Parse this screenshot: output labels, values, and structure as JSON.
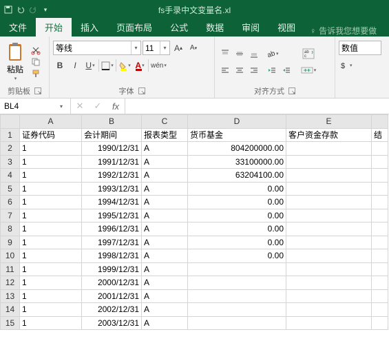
{
  "titlebar": {
    "filename": "fs手录中文变量名.xl"
  },
  "tabs": {
    "file": "文件",
    "home": "开始",
    "insert": "插入",
    "layout": "页面布局",
    "formulas": "公式",
    "data": "数据",
    "review": "审阅",
    "view": "视图",
    "tellme": "告诉我您想要做"
  },
  "ribbon": {
    "clipboard": {
      "paste": "粘贴",
      "label": "剪贴板"
    },
    "font": {
      "name": "等线",
      "size": "11",
      "label": "字体",
      "wen": "wén"
    },
    "alignment": {
      "label": "对齐方式"
    },
    "number": {
      "format": "数值"
    }
  },
  "formula_bar": {
    "cell_ref": "BL4",
    "fx": "fx"
  },
  "sheet": {
    "columns": [
      "A",
      "B",
      "C",
      "D",
      "E",
      ""
    ],
    "headers": {
      "A": "证券代码",
      "B": "会计期间",
      "C": "报表类型",
      "D": "货币基金",
      "E": "客户资金存款",
      "F": "结"
    },
    "rows": [
      {
        "n": "2",
        "A": "1",
        "B": "1990/12/31",
        "C": "A",
        "D": "804200000.00",
        "E": ""
      },
      {
        "n": "3",
        "A": "1",
        "B": "1991/12/31",
        "C": "A",
        "D": "33100000.00",
        "E": ""
      },
      {
        "n": "4",
        "A": "1",
        "B": "1992/12/31",
        "C": "A",
        "D": "63204100.00",
        "E": ""
      },
      {
        "n": "5",
        "A": "1",
        "B": "1993/12/31",
        "C": "A",
        "D": "0.00",
        "E": ""
      },
      {
        "n": "6",
        "A": "1",
        "B": "1994/12/31",
        "C": "A",
        "D": "0.00",
        "E": ""
      },
      {
        "n": "7",
        "A": "1",
        "B": "1995/12/31",
        "C": "A",
        "D": "0.00",
        "E": ""
      },
      {
        "n": "8",
        "A": "1",
        "B": "1996/12/31",
        "C": "A",
        "D": "0.00",
        "E": ""
      },
      {
        "n": "9",
        "A": "1",
        "B": "1997/12/31",
        "C": "A",
        "D": "0.00",
        "E": ""
      },
      {
        "n": "10",
        "A": "1",
        "B": "1998/12/31",
        "C": "A",
        "D": "0.00",
        "E": ""
      },
      {
        "n": "11",
        "A": "1",
        "B": "1999/12/31",
        "C": "A",
        "D": "",
        "E": ""
      },
      {
        "n": "12",
        "A": "1",
        "B": "2000/12/31",
        "C": "A",
        "D": "",
        "E": ""
      },
      {
        "n": "13",
        "A": "1",
        "B": "2001/12/31",
        "C": "A",
        "D": "",
        "E": ""
      },
      {
        "n": "14",
        "A": "1",
        "B": "2002/12/31",
        "C": "A",
        "D": "",
        "E": ""
      },
      {
        "n": "15",
        "A": "1",
        "B": "2003/12/31",
        "C": "A",
        "D": "",
        "E": ""
      }
    ]
  }
}
